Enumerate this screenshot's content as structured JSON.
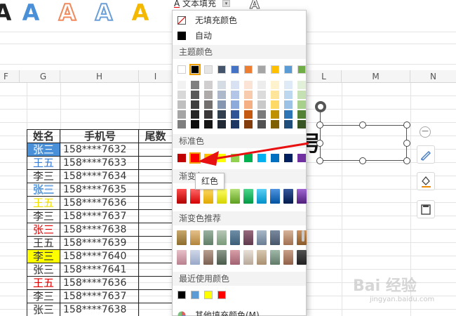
{
  "ribbon": {
    "style_letters": [
      {
        "text": "A",
        "color": "#222222"
      },
      {
        "text": "A",
        "color": "#4a90d9"
      },
      {
        "text": "A",
        "color": "#f08a5d"
      },
      {
        "text": "A",
        "color": "#ffffff"
      },
      {
        "text": "A",
        "color": "#f4b800"
      }
    ],
    "text_fill_button": "文本填充",
    "text_fill_icon": "A",
    "outline_icon": "A"
  },
  "columns": [
    "F",
    "G",
    "H",
    "I",
    "L",
    "M",
    "N"
  ],
  "table": {
    "headers": [
      "姓名",
      "手机号",
      "尾数"
    ],
    "rows": [
      {
        "name": "张三",
        "phone": "158****7632",
        "style": "bg-blue-white"
      },
      {
        "name": "王五",
        "phone": "158****7633",
        "style": "blue"
      },
      {
        "name": "李三",
        "phone": "158****7634",
        "style": "black"
      },
      {
        "name": "张三",
        "phone": "158****7635",
        "style": "outline-blue"
      },
      {
        "name": "王五",
        "phone": "158****7636",
        "style": "yellow"
      },
      {
        "name": "李三",
        "phone": "158****7637",
        "style": "black"
      },
      {
        "name": "张三",
        "phone": "158****7638",
        "style": "red"
      },
      {
        "name": "王五",
        "phone": "158****7639",
        "style": "black"
      },
      {
        "name": "李三",
        "phone": "158****7640",
        "style": "bg-yellow"
      },
      {
        "name": "张三",
        "phone": "158****7641",
        "style": "black"
      },
      {
        "name": "王五",
        "phone": "158****7636",
        "style": "red"
      },
      {
        "name": "李三",
        "phone": "158****7637",
        "style": "black"
      },
      {
        "name": "张三",
        "phone": "158****7638",
        "style": "black"
      }
    ]
  },
  "textbox": {
    "text": "号"
  },
  "color_menu": {
    "no_fill": "无填充颜色",
    "auto": "自动",
    "theme_colors_title": "主题颜色",
    "theme_top_row": [
      "#ffffff",
      "#000000",
      "#e7e6e6",
      "#44546a",
      "#4472c4",
      "#ed7d31",
      "#a5a5a5",
      "#ffc000",
      "#5b9bd5",
      "#70ad47"
    ],
    "theme_shades": [
      [
        "#f2f2f2",
        "#7f7f7f",
        "#d0cece",
        "#d6dce4",
        "#d9e2f3",
        "#fbe4d5",
        "#ededed",
        "#fff2cc",
        "#deebf6",
        "#e2efd9"
      ],
      [
        "#d8d8d8",
        "#595959",
        "#aeaaaa",
        "#adb9ca",
        "#b4c6e7",
        "#f7cbac",
        "#dbdbdb",
        "#fee599",
        "#bdd7ee",
        "#c5e0b3"
      ],
      [
        "#bfbfbf",
        "#3f3f3f",
        "#757070",
        "#8496b0",
        "#8eaadb",
        "#f4b083",
        "#c9c9c9",
        "#ffd965",
        "#9cc3e5",
        "#a8d08d"
      ],
      [
        "#a5a5a5",
        "#262626",
        "#3a3838",
        "#323f4f",
        "#2f5496",
        "#c45911",
        "#7b7b7b",
        "#bf9000",
        "#2e75b5",
        "#538135"
      ],
      [
        "#7f7f7f",
        "#0c0c0c",
        "#171616",
        "#222a35",
        "#1f3763",
        "#833c0b",
        "#525252",
        "#7f6000",
        "#1e4e79",
        "#375623"
      ]
    ],
    "standard_title": "标准色",
    "standard_colors": [
      "#c00000",
      "#ff0000",
      "#ffc000",
      "#ffff00",
      "#92d050",
      "#00b050",
      "#00b0f0",
      "#0070c0",
      "#002060",
      "#7030a0"
    ],
    "gradient_title": "渐变色",
    "gradient_colors": [
      [
        "#ff4d4d",
        "#b00000"
      ],
      [
        "#ff6b6b",
        "#d40000"
      ],
      [
        "#ffd966",
        "#e0a800"
      ],
      [
        "#ffff66",
        "#d4d400"
      ],
      [
        "#b6e27a",
        "#5e9e1f"
      ],
      [
        "#4cd68a",
        "#009944"
      ],
      [
        "#5ad0f5",
        "#0090c8"
      ],
      [
        "#4f94e0",
        "#0052a0"
      ],
      [
        "#34589c",
        "#001a4d"
      ],
      [
        "#a066d3",
        "#4e1f7a"
      ]
    ],
    "gradient_recommend_title": "渐变色推荐",
    "recommend_rows": [
      [
        [
          "#c8a86b",
          "#8c6d2e"
        ],
        [
          "#e4c08a",
          "#b2853c"
        ],
        [
          "#9ab3a0",
          "#5f7d67"
        ],
        [
          "#b8c8b8",
          "#7a9a7a"
        ],
        [
          "#6f8fa8",
          "#3d5e78"
        ],
        [
          "#9a6a7e",
          "#5e3a4c"
        ],
        [
          "#a8b8c8",
          "#6a7e94"
        ],
        [
          "#7a8a9e",
          "#48566a"
        ],
        [
          "#d8b49a",
          "#a07050"
        ],
        [
          "#c89060",
          "#8a5a2a"
        ]
      ],
      [
        [
          "#e8c0c8",
          "#b88090"
        ],
        [
          "#d0d8e8",
          "#98a8c8"
        ],
        [
          "#b8a090",
          "#7a6050"
        ],
        [
          "#8c9a8c",
          "#4a5a4a"
        ],
        [
          "#d8a0a8",
          "#a06070"
        ],
        [
          "#e8e0d8",
          "#b8a898"
        ],
        [
          "#d8c8b0",
          "#a89070"
        ],
        [
          "#a0b8a8",
          "#607a68"
        ],
        [
          "#c8a088",
          "#906048"
        ],
        [
          "#505050",
          "#202020"
        ]
      ]
    ],
    "recent_title": "最近使用颜色",
    "recent_colors": [
      "#000000",
      "#5b9bd5",
      "#ffff00",
      "#ff0000"
    ],
    "more_colors": "其他填充颜色(M)..."
  },
  "tooltip": "红色",
  "watermark": {
    "main": "Bai 经验",
    "sub": "jingyan.baidu.com"
  }
}
